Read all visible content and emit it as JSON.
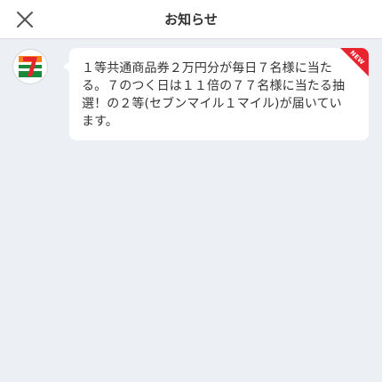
{
  "header": {
    "title": "お知らせ",
    "close_icon": "close-icon"
  },
  "notifications": [
    {
      "sender_icon": "seven-eleven-logo",
      "badge": "NEW",
      "message": "１等共通商品券２万円分が毎日７名様に当たる。７のつく日は１１倍の７７名様に当たる抽選！の２等(セブンマイル１マイル)が届いています。"
    }
  ],
  "colors": {
    "background": "#eceff4",
    "header_bg": "#ffffff",
    "bubble_bg": "#ffffff",
    "text": "#333333",
    "badge_red": "#e8242c",
    "brand_green": "#1a8a3a",
    "brand_orange": "#f58220",
    "brand_red": "#e8242c"
  }
}
